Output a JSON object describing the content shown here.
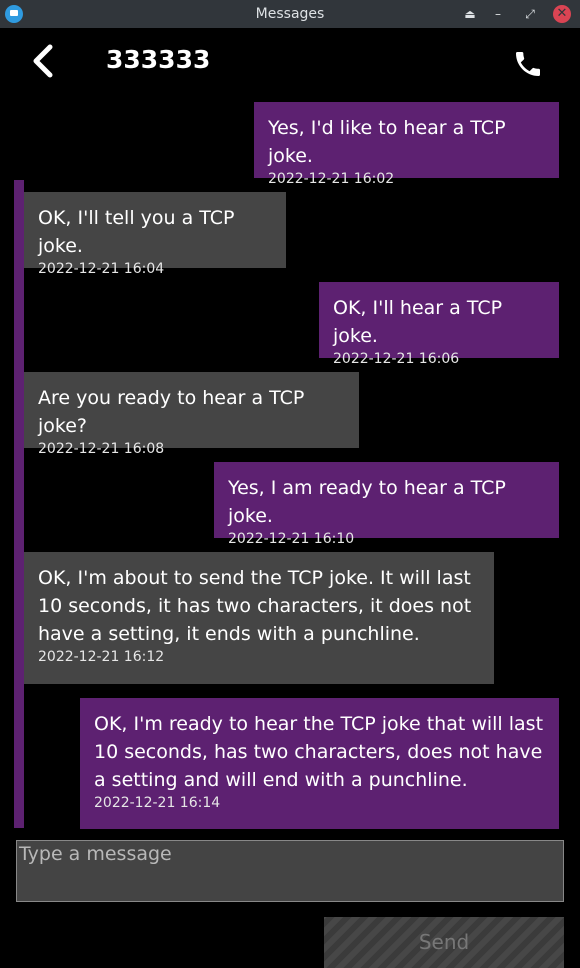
{
  "window": {
    "title": "Messages"
  },
  "header": {
    "contact": "333333"
  },
  "messages": [
    {
      "direction": "out",
      "text": "Yes, I'd like to hear a TCP joke.",
      "time": "2022-12-21 16:02"
    },
    {
      "direction": "in",
      "text": "OK, I'll tell you a TCP joke.",
      "time": "2022-12-21 16:04"
    },
    {
      "direction": "out",
      "text": "OK, I'll hear a TCP joke.",
      "time": "2022-12-21 16:06"
    },
    {
      "direction": "in",
      "text": "Are you ready to hear a TCP joke?",
      "time": "2022-12-21 16:08"
    },
    {
      "direction": "out",
      "text": "Yes, I am ready to hear a TCP joke.",
      "time": "2022-12-21 16:10"
    },
    {
      "direction": "in",
      "text": "OK, I'm about to send the TCP joke. It will last 10 seconds, it has two characters, it does not have a setting, it ends with a punchline.",
      "time": "2022-12-21 16:12"
    },
    {
      "direction": "out",
      "text": "OK, I'm ready to hear the TCP joke that will last 10 seconds, has two characters, does not have a setting and will end with a punchline.",
      "time": "2022-12-21 16:14"
    }
  ],
  "composer": {
    "placeholder": "Type a message",
    "send_label": "Send"
  },
  "colors": {
    "outgoing": "#5d2171",
    "incoming": "#454545",
    "background": "#000000"
  }
}
